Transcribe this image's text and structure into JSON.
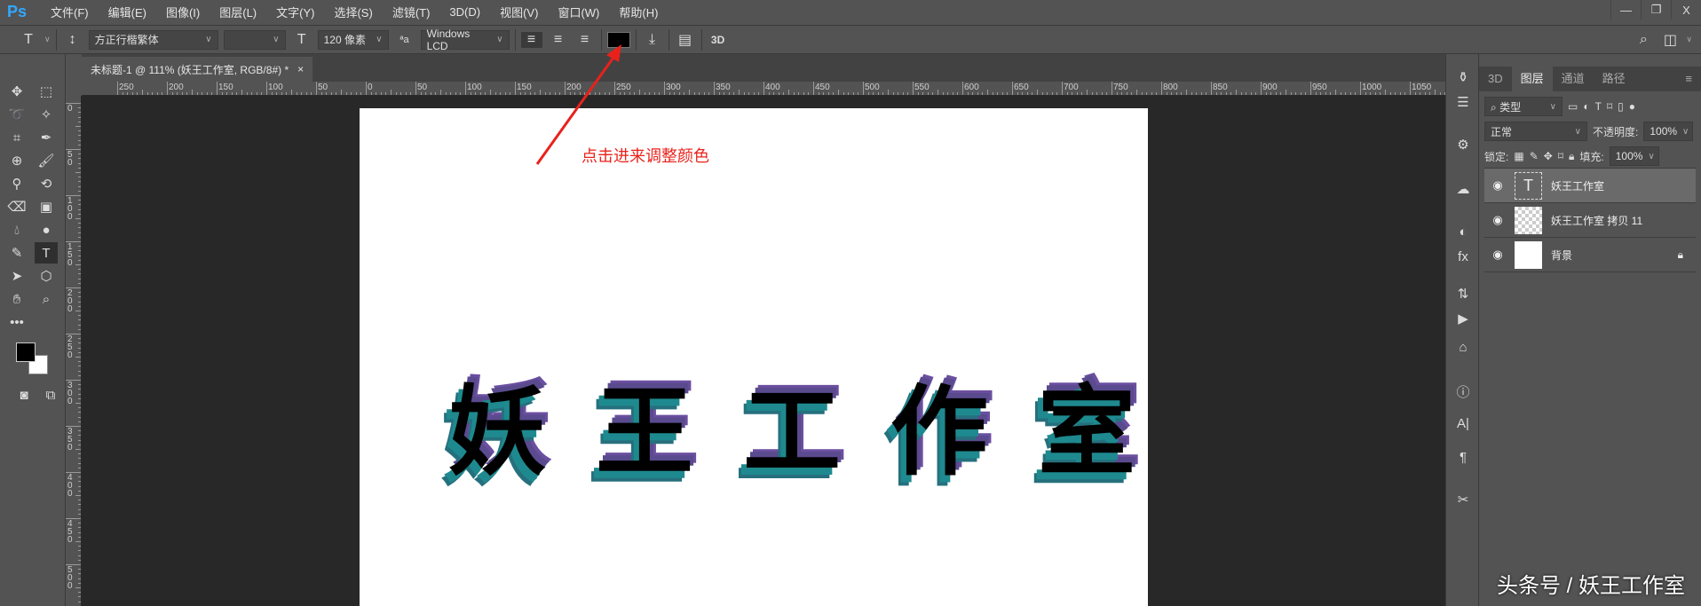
{
  "app": {
    "logo": "Ps",
    "window_controls": [
      "—",
      "❐",
      "X"
    ]
  },
  "menu": [
    "文件(F)",
    "编辑(E)",
    "图像(I)",
    "图层(L)",
    "文字(Y)",
    "选择(S)",
    "滤镜(T)",
    "3D(D)",
    "视图(V)",
    "窗口(W)",
    "帮助(H)"
  ],
  "options": {
    "tool_icon": "T",
    "font_family": "方正行楷繁体",
    "font_style": "",
    "font_size": "120 像素",
    "aa_label": "ªa",
    "antialias": "Windows LCD",
    "text_color": "#000000",
    "label_3d": "3D"
  },
  "document": {
    "tab_title": "未标题-1 @ 111% (妖王工作室, RGB/8#) *",
    "close": "×",
    "hruler": [
      "250",
      "200",
      "150",
      "100",
      "50",
      "0",
      "50",
      "100",
      "150",
      "200",
      "250",
      "300",
      "350",
      "400",
      "450",
      "500",
      "550",
      "600",
      "650",
      "700",
      "750",
      "800",
      "850",
      "900",
      "950",
      "1000",
      "1050"
    ],
    "vruler": [
      "0",
      "50",
      "100",
      "150",
      "200",
      "250",
      "300",
      "350",
      "400",
      "450",
      "500"
    ],
    "art_chars": [
      "妖",
      "王",
      "工",
      "作",
      "室"
    ]
  },
  "annotation": {
    "text": "点击进来调整颜色",
    "color": "#e8221b"
  },
  "layers_panel": {
    "tabs": [
      "3D",
      "图层",
      "通道",
      "路径"
    ],
    "active_tab": "图层",
    "filter": "类型",
    "blend_mode": "正常",
    "opacity_label": "不透明度:",
    "opacity": "100%",
    "lock_label": "锁定:",
    "fill_label": "填充:",
    "fill": "100%",
    "layers": [
      {
        "name": "妖王工作室",
        "type": "text",
        "selected": true
      },
      {
        "name": "妖王工作室 拷贝 11",
        "type": "raster"
      },
      {
        "name": "背景",
        "type": "background",
        "locked": true
      }
    ]
  },
  "watermark": "头条号 / 妖王工作室"
}
